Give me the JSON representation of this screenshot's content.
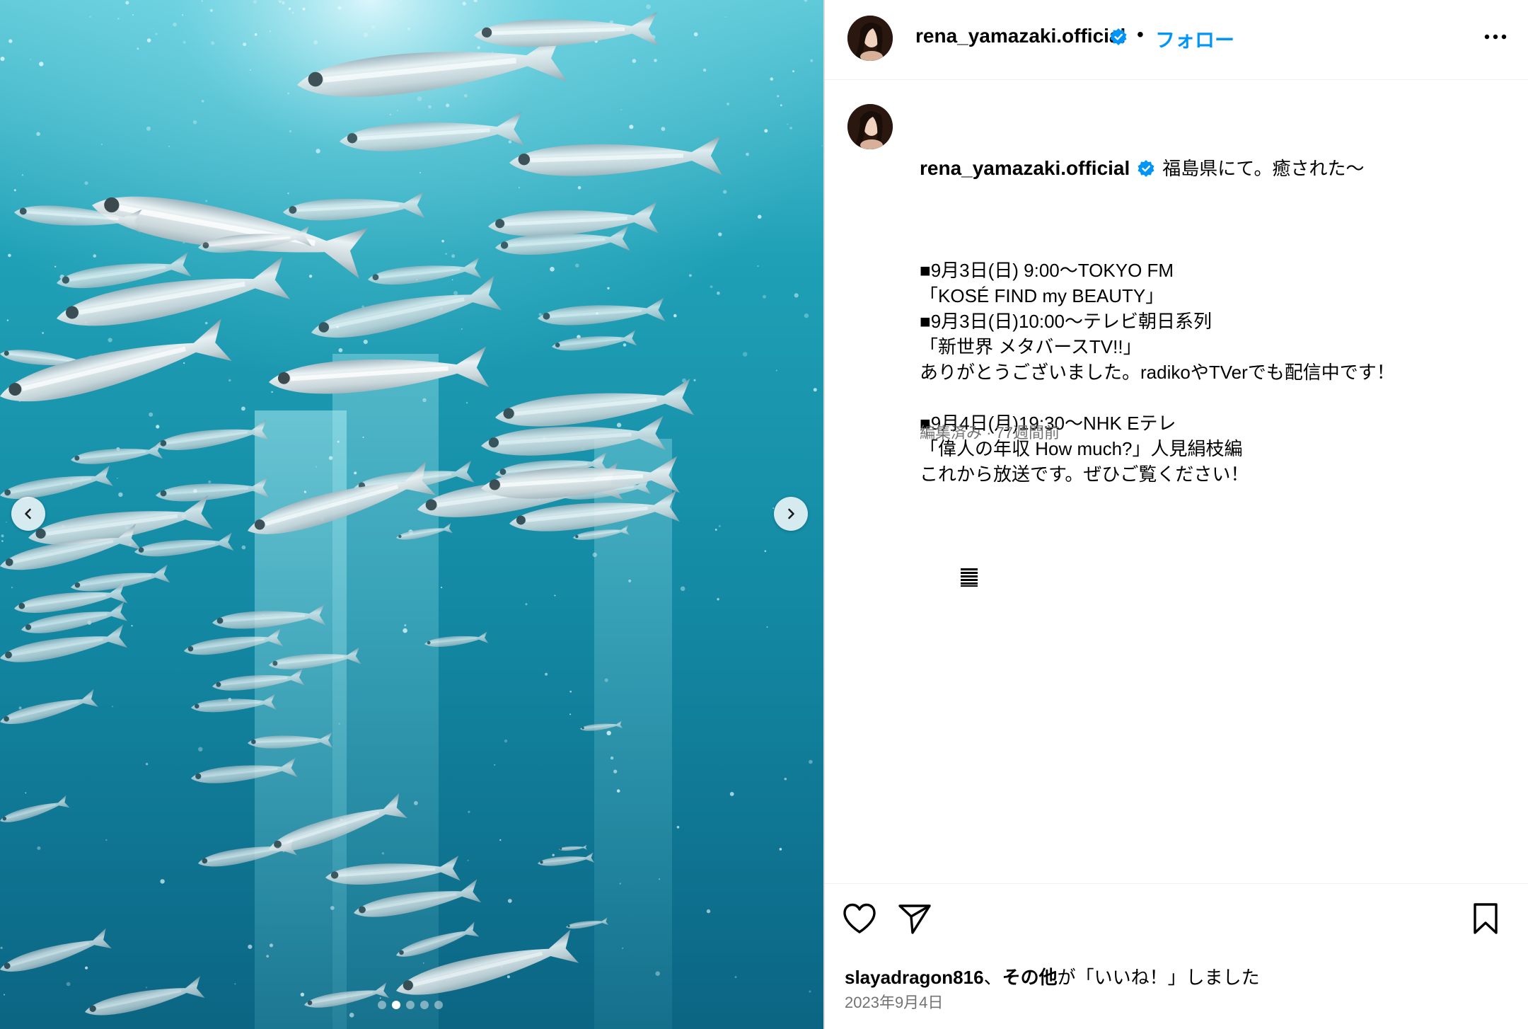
{
  "post": {
    "username": "rena_yamazaki.official",
    "verified": true,
    "separator": "•",
    "follow_label": "フォロー",
    "more_icon": "more-horizontal-icon"
  },
  "media": {
    "description_icon": "underwater-fish-photo",
    "carousel": {
      "prev_icon": "chevron-left-icon",
      "next_icon": "chevron-right-icon",
      "dot_count": 5,
      "active_index": 1
    }
  },
  "caption": {
    "username": "rena_yamazaki.official",
    "first_line": "福島県にて。癒された〜",
    "lines": [
      "■9月3日(日) 9:00〜TOKYO FM",
      "「KOSÉ FIND my BEAUTY」",
      "■9月3日(日)10:00〜テレビ朝日系列",
      "「新世界 メタバースTV!!」",
      "ありがとうございました。radikoやTVerでも配信中です！",
      "",
      "■9月4日(月)19:30〜NHK Eテレ",
      "「偉人の年収 How much?」人見絹枝編",
      "これから放送です。ぜひご覧ください！"
    ],
    "trailing_icon": "bars-emoji-icon"
  },
  "meta": {
    "text": "編集済み · 77週間前"
  },
  "actions": {
    "like_icon": "heart-icon",
    "share_icon": "paper-plane-icon",
    "save_icon": "bookmark-icon",
    "likes_user": "slayadragon816",
    "likes_separator": "、",
    "likes_others": "その他",
    "likes_suffix": "が「いいね！」しました",
    "date": "2023年9月4日"
  },
  "colors": {
    "link_blue": "#0095f6",
    "verified_blue": "#0095f6",
    "secondary_text": "#737373",
    "water_dark": "#0e6f89",
    "water_light": "#6fd4e0"
  }
}
